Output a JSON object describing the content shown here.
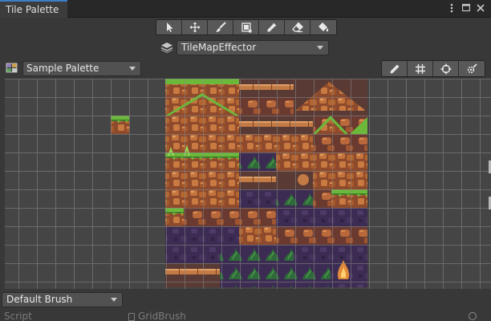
{
  "window": {
    "tab_title": "Tile Palette",
    "tab_icons": [
      "kebab-menu-icon",
      "maximize-icon",
      "close-icon"
    ]
  },
  "tools": [
    {
      "name": "select-tool",
      "icon": "arrow-cursor-icon"
    },
    {
      "name": "move-tool",
      "icon": "move-arrows-icon"
    },
    {
      "name": "paint-tool",
      "icon": "brush-icon"
    },
    {
      "name": "box-fill-tool",
      "icon": "box-fill-icon"
    },
    {
      "name": "picker-tool",
      "icon": "eyedropper-icon"
    },
    {
      "name": "erase-tool",
      "icon": "eraser-icon"
    },
    {
      "name": "fill-tool",
      "icon": "paint-bucket-icon"
    }
  ],
  "active_tilemap": {
    "icon": "tilemap-layers-icon",
    "value": "TileMapEffector"
  },
  "palette": {
    "icon": "palette-icon",
    "value": "Sample Palette"
  },
  "edit_tools": [
    {
      "name": "edit-palette-button",
      "icon": "pencil-icon"
    },
    {
      "name": "toggle-grid-button",
      "icon": "grid-icon"
    },
    {
      "name": "gizmos-button",
      "icon": "crosshair-icon"
    },
    {
      "name": "palette-settings-button",
      "icon": "gear-brush-icon"
    }
  ],
  "brush": {
    "value": "Default Brush"
  },
  "script": {
    "label": "Script",
    "value": "GridBrush",
    "value_icon": "script-icon",
    "picker_icon": "object-picker-icon"
  },
  "colors": {
    "background": "#383838",
    "grid_background": "#454545",
    "grid_line": "#8a8a8a",
    "tab_accent": "#3d7ec9",
    "button": "#585858",
    "dirt_light": "#c0703a",
    "dirt_dark": "#8a4428",
    "grass": "#7cc43a",
    "cave": "#3e2f52"
  }
}
